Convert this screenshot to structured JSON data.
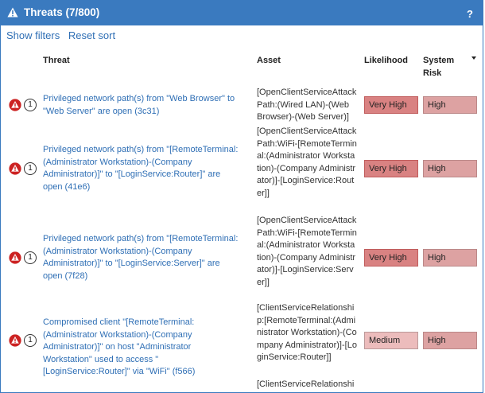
{
  "header": {
    "title": "Threats (7/800)",
    "help": "?",
    "warn_icon": "warning-triangle-icon"
  },
  "links": {
    "show_filters": "Show filters",
    "reset_sort": "Reset sort"
  },
  "columns": {
    "threat": "Threat",
    "asset": "Asset",
    "likelihood": "Likelihood",
    "risk_line1": "System",
    "risk_line2": "Risk"
  },
  "colors": {
    "header_bg": "#3a7abf",
    "link": "#2f6fb5",
    "very_high_bg": "#d98282",
    "high_bg": "#dda2a2",
    "medium_bg": "#ecbcbc",
    "alert_red": "#cc2222"
  },
  "rows": [
    {
      "count": "1",
      "threat": "Privileged network path(s) from \"Web Browser\" to \"Web Server\" are open (3c31)",
      "asset": "[OpenClientServiceAttackPath:(Wired LAN)-(Web Browser)-(Web Server)]",
      "likelihood": "Very High",
      "risk": "High"
    },
    {
      "count": "1",
      "threat": "Privileged network path(s) from \"[RemoteTerminal:(Administrator Workstation)-(Company Administrator)]\" to \"[LoginService:Router]\" are open (41e6)",
      "asset": "[OpenClientServiceAttackPath:WiFi-[RemoteTerminal:(Administrator Workstation)-(Company Administrator)]-[LoginService:Router]]",
      "likelihood": "Very High",
      "risk": "High"
    },
    {
      "count": "1",
      "threat": "Privileged network path(s) from \"[RemoteTerminal:(Administrator Workstation)-(Company Administrator)]\" to \"[LoginService:Server]\" are open (7f28)",
      "asset": "[OpenClientServiceAttackPath:WiFi-[RemoteTerminal:(Administrator Workstation)-(Company Administrator)]-[LoginService:Server]]",
      "likelihood": "Very High",
      "risk": "High"
    },
    {
      "count": "1",
      "threat": "Compromised client \"[RemoteTerminal:(Administrator Workstation)-(Company Administrator)]\" on host \"Administrator Workstation\" used to access \"[LoginService:Router]\" via \"WiFi\" (f566)",
      "asset": "[ClientServiceRelationship:[RemoteTerminal:(Administrator Workstation)-(Company Administrator)]-[LoginService:Router]]",
      "likelihood": "Medium",
      "risk": "High"
    },
    {
      "asset": "[ClientServiceRelationshi"
    }
  ]
}
